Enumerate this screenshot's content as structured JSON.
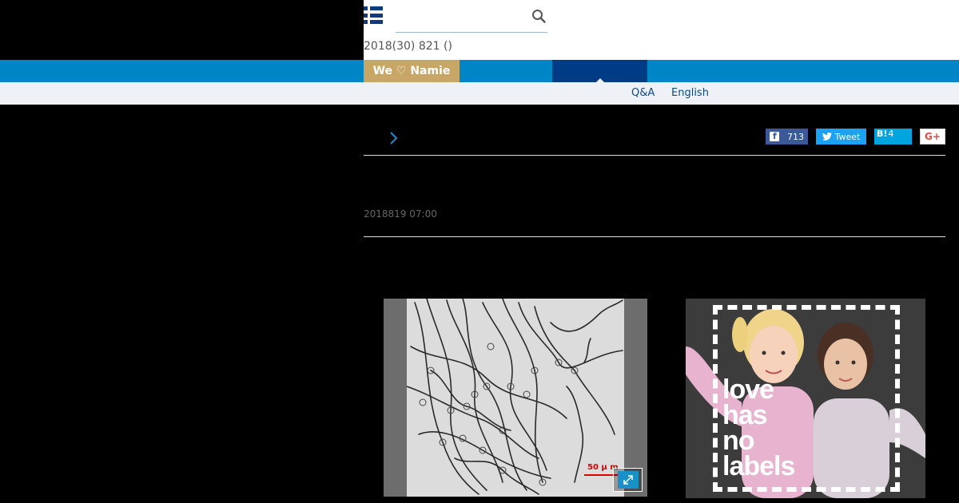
{
  "header": {
    "search_placeholder": "",
    "dateline": "2018(30) 821 ()"
  },
  "nav": {
    "namie_label": "We ♡ Namie",
    "subnav": [
      {
        "label": "Q&A"
      },
      {
        "label": "English"
      }
    ]
  },
  "share": {
    "facebook_count": "713",
    "twitter_label": "Tweet",
    "hatena_label": "B!",
    "hatena_count": "4",
    "google_label": "G+"
  },
  "article": {
    "published": "2018819 07:00"
  },
  "figures": [
    {
      "scale_label": "50 μ m"
    },
    {
      "text_lines": [
        "love",
        "has",
        "no",
        "labels"
      ]
    }
  ],
  "colors": {
    "nav_blue": "#0085c7",
    "nav_active": "#003b86",
    "namie_gold": "#c8a766",
    "facebook": "#3b5998",
    "twitter": "#1da1f2",
    "hatena": "#00a4de"
  }
}
